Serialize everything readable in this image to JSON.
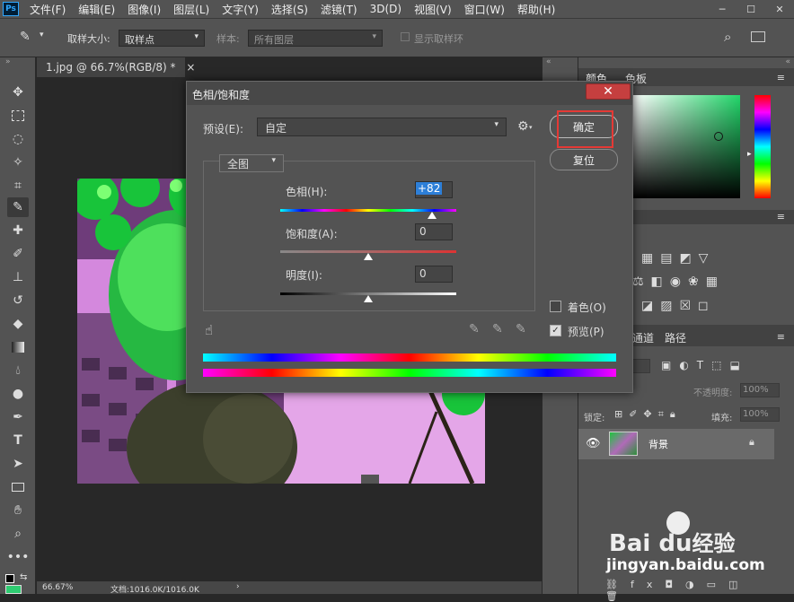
{
  "app": {
    "logo": "Ps"
  },
  "menu": [
    "文件(F)",
    "编辑(E)",
    "图像(I)",
    "图层(L)",
    "文字(Y)",
    "选择(S)",
    "滤镜(T)",
    "3D(D)",
    "视图(V)",
    "窗口(W)",
    "帮助(H)"
  ],
  "options": {
    "sample_size_label": "取样大小:",
    "sample_size_value": "取样点",
    "sample_label": "样本:",
    "sample_value": "所有图层",
    "show_ring_label": "显示取样环"
  },
  "document": {
    "tab_title": "1.jpg @ 66.7%(RGB/8) *",
    "close": "×",
    "zoom": "66.67%",
    "doc_info": "文档:1016.0K/1016.0K"
  },
  "dialog": {
    "title": "色相/饱和度",
    "preset_label": "预设(E):",
    "preset_value": "自定",
    "channel_value": "全图",
    "hue_label": "色相(H):",
    "hue_value": "+82",
    "hue_fraction": 0.86,
    "saturation_label": "饱和度(A):",
    "saturation_value": "0",
    "saturation_fraction": 0.5,
    "lightness_label": "明度(I):",
    "lightness_value": "0",
    "lightness_fraction": 0.5,
    "ok_label": "确定",
    "reset_label": "复位",
    "colorize_label": "着色(O)",
    "colorize_checked": false,
    "preview_label": "预览(P)",
    "preview_checked": true
  },
  "panels": {
    "color_tab": "颜色",
    "swatches_tab": "色板",
    "channels_tab": "通道",
    "paths_tab": "路径",
    "opacity_label": "不透明度:",
    "opacity_value": "100%",
    "lock_label": "锁定:",
    "fill_label": "填充:",
    "fill_value": "100%",
    "layer_name": "背景"
  },
  "watermark": {
    "brand": "Bai du",
    "brand_suffix": "经验",
    "url": "jingyan.baidu.com"
  },
  "colors": {
    "highlight_box": "#e53935",
    "fg_color": "#2ecc71"
  }
}
